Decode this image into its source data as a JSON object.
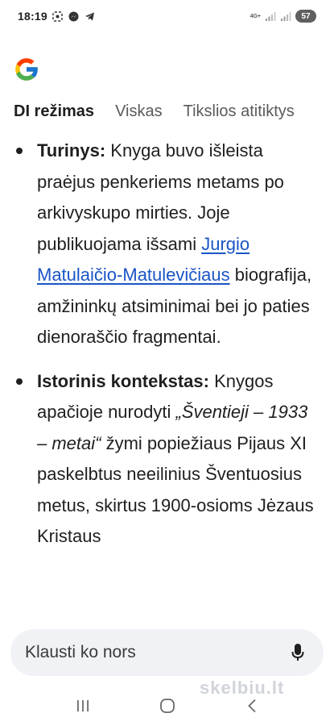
{
  "status_bar": {
    "time": "18:19",
    "network": "4G+",
    "battery": "57"
  },
  "tabs": [
    {
      "label": "DI režimas",
      "active": true
    },
    {
      "label": "Viskas",
      "active": false
    },
    {
      "label": "Tikslios atitiktys",
      "active": false
    }
  ],
  "content": {
    "items": [
      {
        "term": "Turinys:",
        "text_1": " Knyga buvo išleista praėjus penkeriems metams po arkivyskupo mirties. Joje publikuojama išsami ",
        "link": "Jurgio Matulaičio-Matulevičiaus",
        "text_2": " biografija, amžininkų atsiminimai bei jo paties dienoraščio fragmentai."
      },
      {
        "term": "Istorinis kontekstas:",
        "text_1": " Knygos apačioje nurodyti ",
        "quote": "„Šventieji – 1933 – metai“",
        "text_2": " žymi popiežiaus Pijaus XI paskelbtus neeilinius Šventuosius metus, skirtus 1900-osioms Jėzaus Kristaus"
      }
    ]
  },
  "search": {
    "placeholder": "Klausti ko nors"
  },
  "watermark": "skelbiu.lt",
  "colors": {
    "link": "#1a55c6",
    "text": "#1f1f1f",
    "search_bg": "#f0f2f5"
  }
}
